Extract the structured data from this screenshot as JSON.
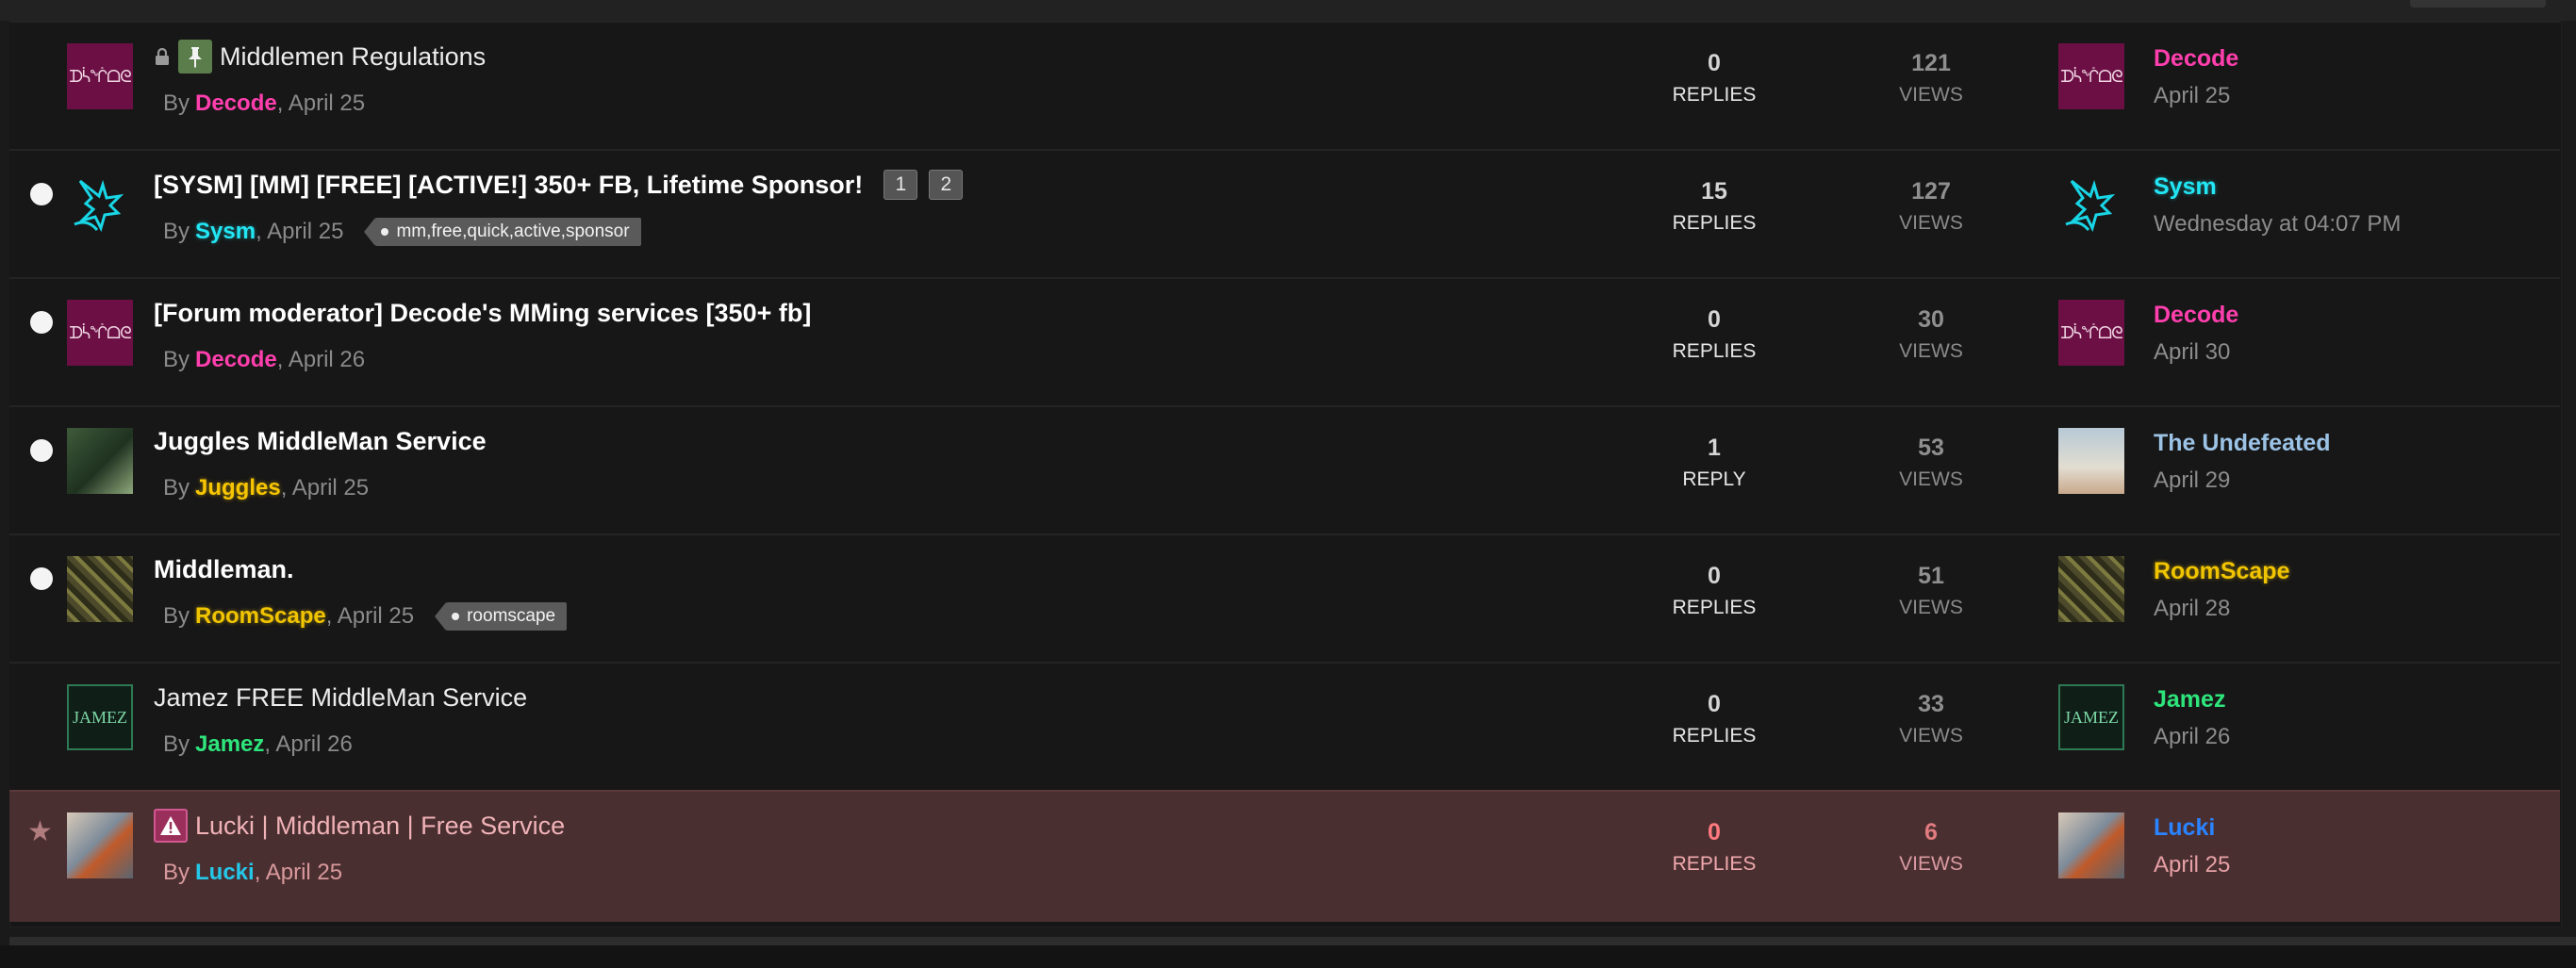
{
  "columns": {
    "replies_label": "REPLIES",
    "reply_label": "REPLY",
    "views_label": "VIEWS"
  },
  "colors": {
    "row_highlight": "#4a2f31",
    "decode": "#ff3fae",
    "sysm": "#22e6f4",
    "juggles": "#f7c600",
    "jamez": "#2ee57c",
    "lucki": "#2a83ff"
  },
  "threads": [
    {
      "title": "Middlemen Regulations",
      "by": "By",
      "author": "Decode",
      "date": ", April 25",
      "replies": "0",
      "replies_label": "REPLIES",
      "views": "121",
      "views_label": "VIEWS",
      "last_user": "Decode",
      "last_date": "April 25",
      "icons": [
        "lock-icon",
        "pin-icon"
      ]
    },
    {
      "title": "[SYSM] [MM] [FREE] [ACTIVE!] 350+ FB, Lifetime Sponsor!",
      "pages": [
        "1",
        "2"
      ],
      "by": "By",
      "author": "Sysm",
      "date": ", April 25",
      "tag": "mm,free,quick,active,sponsor",
      "replies": "15",
      "replies_label": "REPLIES",
      "views": "127",
      "views_label": "VIEWS",
      "last_user": "Sysm",
      "last_date": "Wednesday at 04:07 PM"
    },
    {
      "title": "[Forum moderator] Decode's MMing services [350+ fb]",
      "by": "By",
      "author": "Decode",
      "date": ", April 26",
      "replies": "0",
      "replies_label": "REPLIES",
      "views": "30",
      "views_label": "VIEWS",
      "last_user": "Decode",
      "last_date": "April 30"
    },
    {
      "title": "Juggles MiddleMan Service",
      "by": "By",
      "author": "Juggles",
      "date": ", April 25",
      "replies": "1",
      "replies_label": "REPLY",
      "views": "53",
      "views_label": "VIEWS",
      "last_user": "The Undefeated",
      "last_date": "April 29"
    },
    {
      "title": "Middleman.",
      "by": "By",
      "author": "RoomScape",
      "date": ", April 25",
      "tag": "roomscape",
      "replies": "0",
      "replies_label": "REPLIES",
      "views": "51",
      "views_label": "VIEWS",
      "last_user": "RoomScape",
      "last_date": "April 28"
    },
    {
      "title": "Jamez FREE MiddleMan Service",
      "by": "By",
      "author": "Jamez",
      "date": ", April 26",
      "replies": "0",
      "replies_label": "REPLIES",
      "views": "33",
      "views_label": "VIEWS",
      "last_user": "Jamez",
      "last_date": "April 26"
    },
    {
      "title": "Lucki | Middleman | Free Service",
      "by": "By",
      "author": "Lucki",
      "date": ", April 25",
      "replies": "0",
      "replies_label": "REPLIES",
      "views": "6",
      "views_label": "VIEWS",
      "last_user": "Lucki",
      "last_date": "April 25",
      "icons": [
        "warning-icon",
        "star-icon"
      ]
    }
  ]
}
